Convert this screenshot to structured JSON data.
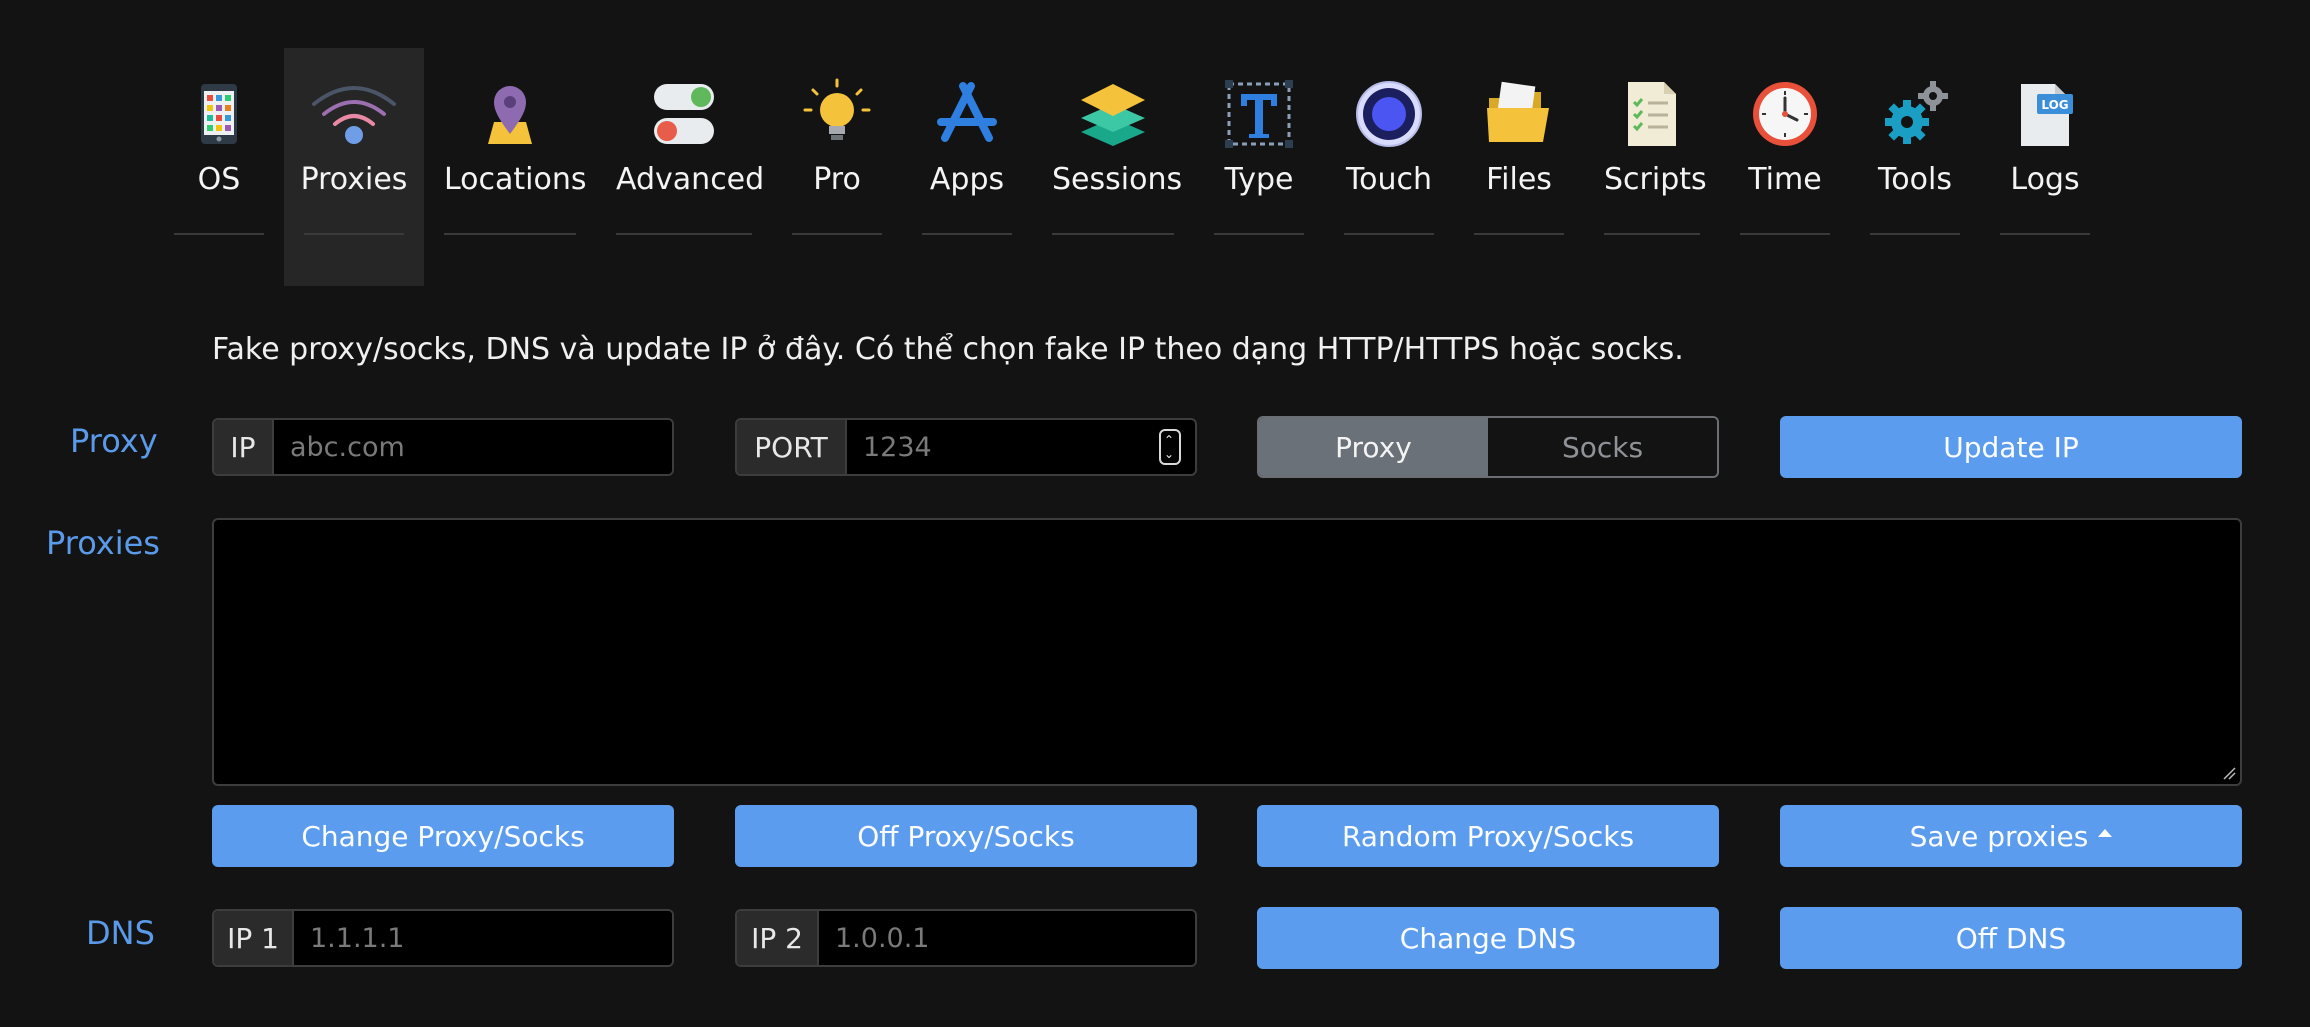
{
  "nav": {
    "tabs": [
      {
        "id": "os",
        "label": "OS",
        "icon": "phone-icon"
      },
      {
        "id": "proxies",
        "label": "Proxies",
        "icon": "wifi-icon",
        "active": true
      },
      {
        "id": "locations",
        "label": "Locations",
        "icon": "map-pin-icon"
      },
      {
        "id": "advanced",
        "label": "Advanced",
        "icon": "toggle-icon"
      },
      {
        "id": "pro",
        "label": "Pro",
        "icon": "lightbulb-icon"
      },
      {
        "id": "apps",
        "label": "Apps",
        "icon": "app-store-icon"
      },
      {
        "id": "sessions",
        "label": "Sessions",
        "icon": "layers-icon"
      },
      {
        "id": "type",
        "label": "Type",
        "icon": "text-type-icon"
      },
      {
        "id": "touch",
        "label": "Touch",
        "icon": "touch-circle-icon"
      },
      {
        "id": "files",
        "label": "Files",
        "icon": "folder-icon"
      },
      {
        "id": "scripts",
        "label": "Scripts",
        "icon": "checklist-icon"
      },
      {
        "id": "time",
        "label": "Time",
        "icon": "clock-icon"
      },
      {
        "id": "tools",
        "label": "Tools",
        "icon": "gears-icon"
      },
      {
        "id": "logs",
        "label": "Logs",
        "icon": "log-file-icon"
      }
    ]
  },
  "description": "Fake proxy/socks, DNS và update IP ở đây. Có thể chọn fake IP theo dạng HTTP/HTTPS hoặc socks.",
  "proxy_row": {
    "label": "Proxy",
    "ip_addon": "IP",
    "ip_placeholder": "abc.com",
    "port_addon": "PORT",
    "port_placeholder": "1234",
    "mode_options": [
      "Proxy",
      "Socks"
    ],
    "mode_selected": "Proxy",
    "update_button": "Update IP"
  },
  "proxies_row": {
    "label": "Proxies",
    "value": ""
  },
  "proxy_actions": {
    "change": "Change Proxy/Socks",
    "off": "Off Proxy/Socks",
    "random": "Random Proxy/Socks",
    "save": "Save proxies"
  },
  "dns_row": {
    "label": "DNS",
    "ip1_addon": "IP 1",
    "ip1_placeholder": "1.1.1.1",
    "ip2_addon": "IP 2",
    "ip2_placeholder": "1.0.0.1",
    "change_button": "Change DNS",
    "off_button": "Off DNS"
  },
  "colors": {
    "accent": "#5b9cee",
    "label_blue": "#5a9ae8",
    "background": "#131313"
  }
}
